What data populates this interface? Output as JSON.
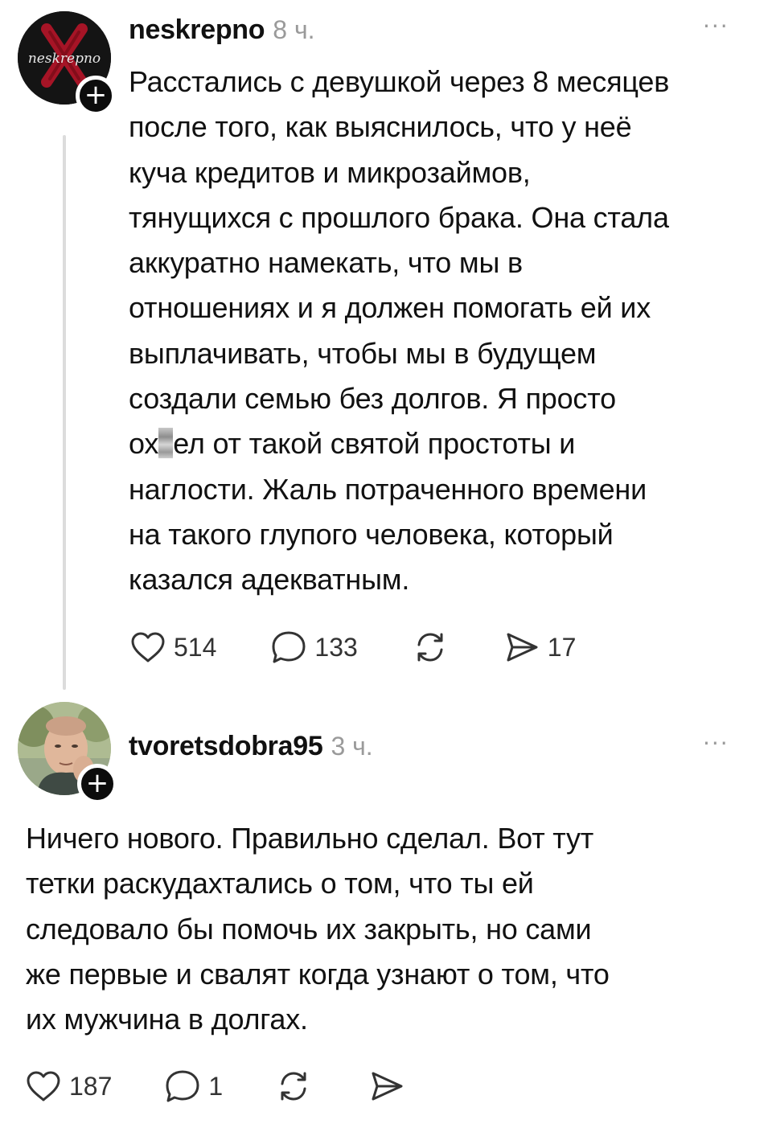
{
  "posts": [
    {
      "username": "neskrepno",
      "avatar_label": "neskrepno",
      "time": "8 ч.",
      "more_icon": "···",
      "follow_icon": "+",
      "text_before_censor": "Расстались с девушкой через 8 месяцев\nпосле того, как выяснилось, что у неё\nкуча кредитов и микрозаймов,\nтянущихся с прошлого брака. Она стала\nаккуратно намекать, что мы в\nотношениях и я должен помогать ей их\nвыплачивать, чтобы мы в будущем\nсоздали семью без долгов. Я просто\nох",
      "text_after_censor": "ел от такой святой простоты и\nнаглости. Жаль потраченного времени\nна такого глупого человека, который\nказался адекватным.",
      "likes": "514",
      "comments": "133",
      "shares": "17"
    },
    {
      "username": "tvoretsdobra95",
      "time": "3 ч.",
      "more_icon": "···",
      "follow_icon": "+",
      "text": "Ничего нового. Правильно сделал. Вот тут\nтетки раскудахтались о том, что ты ей\nследовало бы помочь их закрыть, но сами\nже первые и свалят когда узнают о том, что\nих мужчина в долгах.",
      "likes": "187",
      "comments": "1"
    }
  ],
  "icons": [
    "heart-icon",
    "comment-icon",
    "repost-icon",
    "share-icon",
    "more-icon",
    "plus-icon"
  ],
  "colors": {
    "text": "#111111",
    "muted": "#9a9a9a",
    "thread_line": "#dcdcdc",
    "avatar_dark": "#121212",
    "accent_red": "#c0152a"
  }
}
